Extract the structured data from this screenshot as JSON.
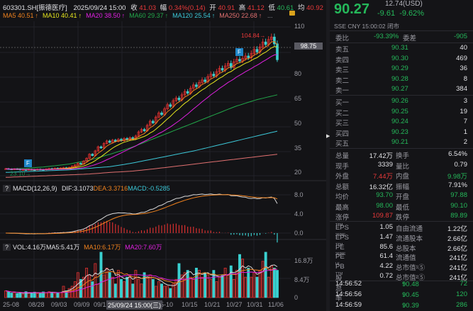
{
  "header": {
    "symbol": "603301.SH[振德医疗]",
    "datetime": "2025/09/24 15:00",
    "close_label": "收",
    "close": "41.03",
    "change_label": "幅",
    "change": "0.34%(0.14)",
    "open_label": "开",
    "open": "40.91",
    "high_label": "高",
    "high": "41.12",
    "low_label": "低",
    "low": "40.61",
    "avg_label": "均",
    "avg": "40.92"
  },
  "ma_legend": [
    {
      "label": "MA5 40.51",
      "color": "#f0821e"
    },
    {
      "label": "MA10 40.41",
      "color": "#e6e61e"
    },
    {
      "label": "MA20 38.50",
      "color": "#e020e0"
    },
    {
      "label": "MA60 29.37",
      "color": "#22a84a"
    },
    {
      "label": "MA120 25.54",
      "color": "#3cc8d8"
    },
    {
      "label": "MA250 22.68",
      "color": "#e07070"
    }
  ],
  "ma_more": "...",
  "main_axis": [
    "110",
    "95",
    "80",
    "65",
    "50",
    "35",
    "20"
  ],
  "crosshair_price": "98.75",
  "max_label": "104.84",
  "min_label": "23.10",
  "flag_label": "F",
  "macd": {
    "title": "MACD(12,26,9)",
    "dif": "DIF:3.1073",
    "dea": "DEA:3.3716",
    "macd": "MACD:-0.5285",
    "axis": [
      "8.0",
      "4.0",
      "0.0"
    ]
  },
  "vol": {
    "title": "VOL:4.16万",
    "ma5": "MA5:5.41万",
    "ma10": "MA10:6.17万",
    "ma20": "MA20:7.60万",
    "axis": [
      "16.8万",
      "8.4万",
      "0"
    ]
  },
  "dates": [
    "25-08",
    "08/28",
    "09/03",
    "09/09",
    "09/1",
    "5-10",
    "10/15",
    "10/21",
    "10/27",
    "10/31",
    "11/06"
  ],
  "cursor_date": "25/09/24 15:00(三)",
  "colors": {
    "up": "#d8302f",
    "down": "#3ad0d0",
    "ma5": "#f0821e",
    "ma10": "#e6e61e",
    "ma20": "#e020e0",
    "ma60": "#22a84a",
    "ma120": "#3cc8d8",
    "ma250": "#e07070",
    "dif": "#d8d8d8",
    "dea": "#f0821e"
  },
  "chart_data": {
    "type": "candlestick",
    "close": [
      24.2,
      24.0,
      23.8,
      24.1,
      23.9,
      23.5,
      23.6,
      23.4,
      23.8,
      23.6,
      23.5,
      23.9,
      23.7,
      23.6,
      24.0,
      24.3,
      24.1,
      24.5,
      24.2,
      24.6,
      24.8,
      24.5,
      25.0,
      25.8,
      26.5,
      27.5,
      27.0,
      28.8,
      30.5,
      33.0,
      32.2,
      35.0,
      37.5,
      36.8,
      39.5,
      41.0,
      40.2,
      41.5,
      40.8,
      42.0,
      41.2,
      42.5,
      41.8,
      43.0,
      42.2,
      44.0,
      46.5,
      48.0,
      47.2,
      50.5,
      53.0,
      52.0,
      55.5,
      58.0,
      57.0,
      60.5,
      63.0,
      62.0,
      65.5,
      67.0,
      66.0,
      69.0,
      71.0,
      70.0,
      73.0,
      75.0,
      74.0,
      76.5,
      78.0,
      77.0,
      80.0,
      81.5,
      80.5,
      83.0,
      85.0,
      84.0,
      86.5,
      88.0,
      85.5,
      89.0,
      90.5,
      89.5,
      91.0,
      92.5,
      91.5,
      94.0,
      96.5,
      95.0,
      98.0,
      101.0,
      99.5,
      102.5,
      104.0,
      99.88,
      90.27
    ],
    "volume_wan": [
      3,
      2.5,
      2,
      2.2,
      1.8,
      2,
      1.5,
      2.6,
      2,
      2.2,
      2.4,
      1.8,
      2,
      2.5,
      2.2,
      2.6,
      2.4,
      1.8,
      2,
      2.2,
      5,
      3,
      4,
      5,
      7,
      11,
      8,
      9,
      13,
      10,
      7,
      15,
      6,
      20,
      10,
      13,
      11,
      9,
      6,
      12,
      8,
      7,
      9,
      10,
      6,
      12,
      8,
      6,
      11,
      9,
      10,
      8,
      5,
      7,
      6,
      5,
      5,
      4,
      6,
      8,
      15,
      10,
      11,
      12,
      9,
      8,
      13,
      12,
      9,
      11,
      10,
      8,
      12,
      7,
      9,
      10,
      13,
      10,
      14,
      8,
      12,
      19,
      17,
      9,
      13,
      9,
      11,
      9,
      12,
      16,
      20,
      9,
      14,
      13,
      12
    ],
    "ma_long": {
      "ma60": [
        24,
        24.5,
        25.5,
        27,
        29.4,
        33,
        37,
        42,
        47,
        52,
        57,
        62,
        66,
        69
      ],
      "ma120": [
        22,
        22.5,
        23,
        23.5,
        24.5,
        25.5,
        27.5,
        30,
        32.5,
        35,
        38,
        41,
        44,
        47
      ],
      "ma250": [
        19,
        19.5,
        20,
        20.5,
        21,
        22,
        22.7,
        24,
        25.5,
        27,
        28.5,
        30,
        31.5,
        33
      ]
    },
    "y_range": [
      20,
      112
    ]
  },
  "quote": {
    "price": "90.27",
    "usd": "12.74(USD)",
    "change": "-9.61",
    "pct": "-9.62%",
    "market": "SSE  CNY  15:00:02  闭市",
    "wb_label": "委比",
    "wb": "-93.39%",
    "wc_label": "委差",
    "wc": "-905"
  },
  "asks": [
    {
      "label": "卖五",
      "price": "90.31",
      "vol": "40"
    },
    {
      "label": "卖四",
      "price": "90.30",
      "vol": "469"
    },
    {
      "label": "卖三",
      "price": "90.29",
      "vol": "36"
    },
    {
      "label": "卖二",
      "price": "90.28",
      "vol": "8"
    },
    {
      "label": "卖一",
      "price": "90.27",
      "vol": "384"
    }
  ],
  "bids": [
    {
      "label": "买一",
      "price": "90.26",
      "vol": "3"
    },
    {
      "label": "买二",
      "price": "90.25",
      "vol": "19"
    },
    {
      "label": "买三",
      "price": "90.24",
      "vol": "7"
    },
    {
      "label": "买四",
      "price": "90.23",
      "vol": "1"
    },
    {
      "label": "买五",
      "price": "90.21",
      "vol": "2"
    }
  ],
  "stats": [
    {
      "l1": "总量",
      "v1": "17.42万",
      "c1": "white",
      "l2": "换手",
      "v2": "6.54%",
      "c2": "white"
    },
    {
      "l1": "现手",
      "v1": "3339",
      "c1": "white",
      "l2": "量比",
      "v2": "0.79",
      "c2": "white"
    },
    {
      "l1": "外盘",
      "v1": "7.44万",
      "c1": "red",
      "l2": "内盘",
      "v2": "9.98万",
      "c2": "green"
    },
    {
      "l1": "总额",
      "v1": "16.32亿",
      "c1": "white",
      "l2": "振幅",
      "v2": "7.91%",
      "c2": "white"
    },
    {
      "l1": "均价",
      "v1": "93.70",
      "c1": "green",
      "l2": "开盘",
      "v2": "97.88",
      "c2": "green"
    },
    {
      "l1": "最高",
      "v1": "98.00",
      "c1": "green",
      "l2": "最低",
      "v2": "90.10",
      "c2": "green"
    },
    {
      "l1": "涨停",
      "v1": "109.87",
      "c1": "red",
      "l2": "跌停",
      "v2": "89.89",
      "c2": "green"
    }
  ],
  "fund": [
    {
      "l1": "EPS",
      "s1": "TTM",
      "v1": "1.05",
      "l2": "自由流通",
      "v2": "1.22亿"
    },
    {
      "l1": "EPS",
      "s1": "2025E",
      "v1": "1.47",
      "l2": "流通股本",
      "v2": "2.66亿"
    },
    {
      "l1": "PE",
      "s1": "TTM",
      "v1": "85.6",
      "l2": "总股本",
      "v2": "2.66亿"
    },
    {
      "l1": "PE",
      "s1": "2025E",
      "v1": "61.4",
      "l2": "流通值",
      "v2": "241亿"
    },
    {
      "l1": "PB",
      "s1": "LF",
      "v1": "4.22",
      "l2": "总市值¹⑤",
      "v2": "241亿"
    },
    {
      "l1": "股息率",
      "s1": "TTM",
      "v1": "0.72",
      "l2": "总市值²⑤",
      "v2": "241亿"
    }
  ],
  "ticks": [
    {
      "time": "14:56:52",
      "price": "90.48",
      "dir": "up",
      "vol": "72"
    },
    {
      "time": "14:56:56",
      "price": "90.45",
      "dir": "down",
      "vol": "120"
    },
    {
      "time": "14:56:59",
      "price": "90.39",
      "dir": "down",
      "vol": "286"
    }
  ]
}
